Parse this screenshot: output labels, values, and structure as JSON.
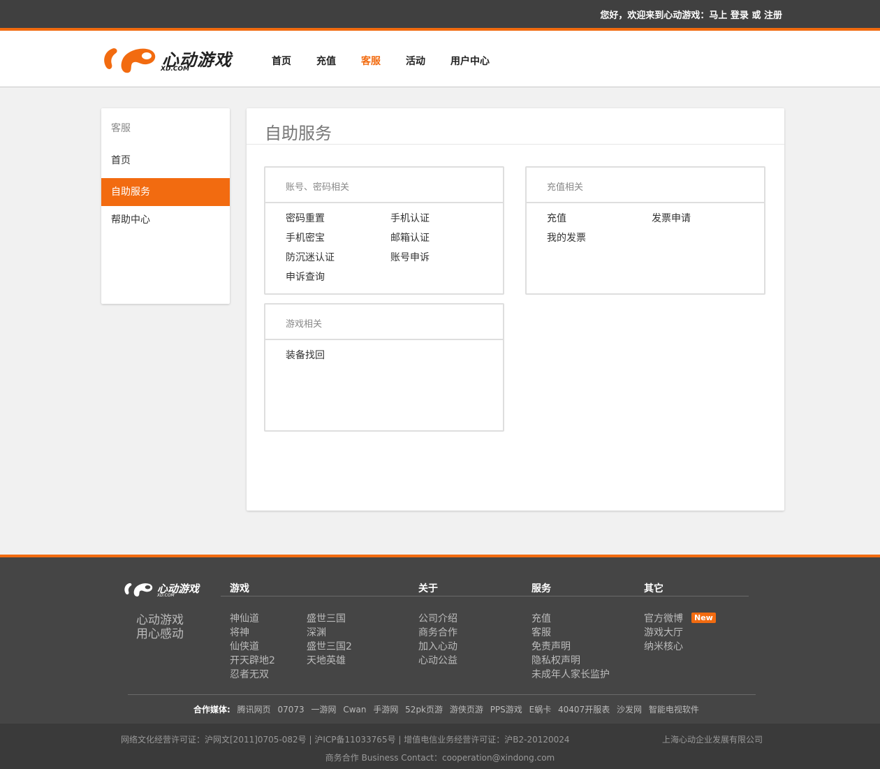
{
  "topbar": {
    "greeting": "您好，欢迎来到心动游戏：马上",
    "login": "登录",
    "or": "或",
    "register": "注册"
  },
  "logo": {
    "name": "心动游戏",
    "domain": "XD.COM"
  },
  "nav": {
    "items": [
      {
        "label": "首页"
      },
      {
        "label": "充值"
      },
      {
        "label": "客服",
        "active": true
      },
      {
        "label": "活动"
      },
      {
        "label": "用户中心"
      }
    ]
  },
  "sidebar": {
    "title": "客服",
    "items": [
      {
        "label": "首页"
      },
      {
        "label": "自助服务",
        "active": true
      },
      {
        "label": "帮助中心"
      }
    ]
  },
  "main": {
    "title": "自助服务",
    "cards": [
      {
        "title": "账号、密码相关",
        "links": [
          "密码重置",
          "手机认证",
          "手机密宝",
          "邮箱认证",
          "防沉迷认证",
          "账号申诉",
          "申诉查询"
        ]
      },
      {
        "title": "充值相关",
        "links": [
          "充值",
          "发票申请",
          "我的发票"
        ]
      },
      {
        "title": "游戏相关",
        "links": [
          "装备找回"
        ]
      }
    ]
  },
  "footer": {
    "logo_name": "心动游戏",
    "logo_domain": "XD.COM",
    "slogan_line1": "心动游戏",
    "slogan_line2": "用心感动",
    "columns": {
      "games": {
        "title": "游戏",
        "col1": [
          "神仙道",
          "将神",
          "仙侠道",
          "开天辟地2",
          "忍者无双"
        ],
        "col2": [
          "盛世三国",
          "深渊",
          "盛世三国2",
          "天地英雄"
        ]
      },
      "about": {
        "title": "关于",
        "items": [
          "公司介绍",
          "商务合作",
          "加入心动",
          "心动公益"
        ]
      },
      "service": {
        "title": "服务",
        "items": [
          "充值",
          "客服",
          "免责声明",
          "隐私权声明",
          "未成年人家长监护"
        ]
      },
      "other": {
        "title": "其它",
        "items": [
          "官方微博",
          "游戏大厅",
          "纳米核心"
        ],
        "new_badge": "New"
      }
    },
    "partners_label": "合作媒体:",
    "partners": [
      "腾讯网页",
      "07073",
      "一游网",
      "Cwan",
      "手游网",
      "52pk页游",
      "游侠页游",
      "PPS游戏",
      "E蜗卡",
      "40407开服表",
      "沙发网",
      "智能电视软件"
    ],
    "license": "网络文化经营许可证：沪网文[2011]0705-082号 | 沪ICP备11033765号 | 增值电信业务经营许可证：沪B2-20120024",
    "company": "上海心动企业发展有限公司",
    "contact": "商务合作 Business Contact：cooperation@xindong.com"
  },
  "colors": {
    "accent": "#f26b10",
    "topbar": "#404040",
    "footer": "#454545"
  }
}
